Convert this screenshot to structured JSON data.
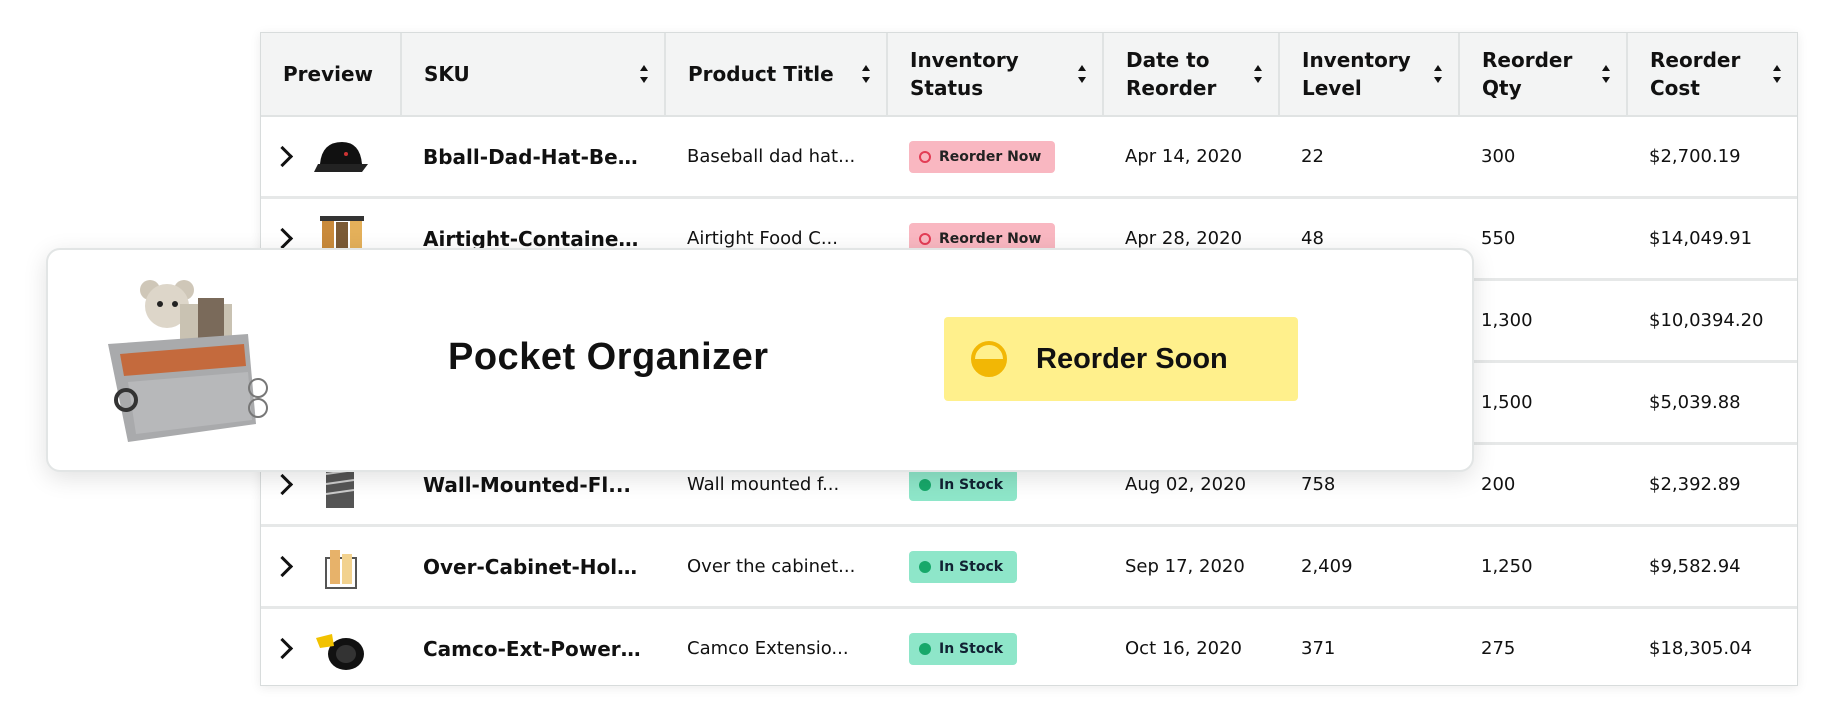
{
  "table": {
    "columns": [
      {
        "label": "Preview",
        "sortable": false
      },
      {
        "label": "SKU",
        "sortable": true
      },
      {
        "label": "Product Title",
        "sortable": true
      },
      {
        "label": "Inventory Status",
        "sortable": true
      },
      {
        "label": "Date to Reorder",
        "sortable": true
      },
      {
        "label": "Inventory Level",
        "sortable": true
      },
      {
        "label": "Reorder Qty",
        "sortable": true
      },
      {
        "label": "Reorder Cost",
        "sortable": true
      }
    ],
    "rows": [
      {
        "sku": "Bball-Dad-Hat-Beige",
        "title": "Baseball dad hat...",
        "status": "Reorder Now",
        "status_type": "reorder-now",
        "date": "Apr 14, 2020",
        "level": "22",
        "qty": "300",
        "cost": "$2,700.19",
        "icon": "cap-thumbnail"
      },
      {
        "sku": "Airtight-Container...",
        "title": "Airtight Food C...",
        "status": "Reorder Now",
        "status_type": "reorder-now",
        "date": "Apr 28, 2020",
        "level": "48",
        "qty": "550",
        "cost": "$14,049.91",
        "icon": "containers-thumbnail"
      },
      {
        "sku": "",
        "title": "",
        "status": "",
        "status_type": "hidden",
        "date": "",
        "level": "",
        "qty": "1,300",
        "cost": "$10,0394.20",
        "icon": ""
      },
      {
        "sku": "",
        "title": "",
        "status": "",
        "status_type": "hidden",
        "date": "",
        "level": "",
        "qty": "1,500",
        "cost": "$5,039.88",
        "icon": ""
      },
      {
        "sku": "Wall-Mounted-Fl...",
        "title": "Wall mounted f...",
        "status": "In Stock",
        "status_type": "in-stock",
        "date": "Aug 02, 2020",
        "level": "758",
        "qty": "200",
        "cost": "$2,392.89",
        "icon": "file-rack-thumbnail"
      },
      {
        "sku": "Over-Cabinet-Holder",
        "title": "Over the cabinet...",
        "status": "In Stock",
        "status_type": "in-stock",
        "date": "Sep 17, 2020",
        "level": "2,409",
        "qty": "1,250",
        "cost": "$9,582.94",
        "icon": "cabinet-holder-thumbnail"
      },
      {
        "sku": "Camco-Ext-PowerGrip",
        "title": "Camco Extensio...",
        "status": "In Stock",
        "status_type": "in-stock",
        "date": "Oct 16, 2020",
        "level": "371",
        "qty": "275",
        "cost": "$18,305.04",
        "icon": "cord-reel-thumbnail"
      }
    ]
  },
  "card": {
    "title": "Pocket Organizer",
    "status": "Reorder Soon",
    "icon": "pocket-organizer-image"
  },
  "colors": {
    "reorder_now": "#f9b7c1",
    "in_stock": "#8ee6c9",
    "reorder_soon": "#fff08c",
    "soon_icon": "#f2b705"
  }
}
